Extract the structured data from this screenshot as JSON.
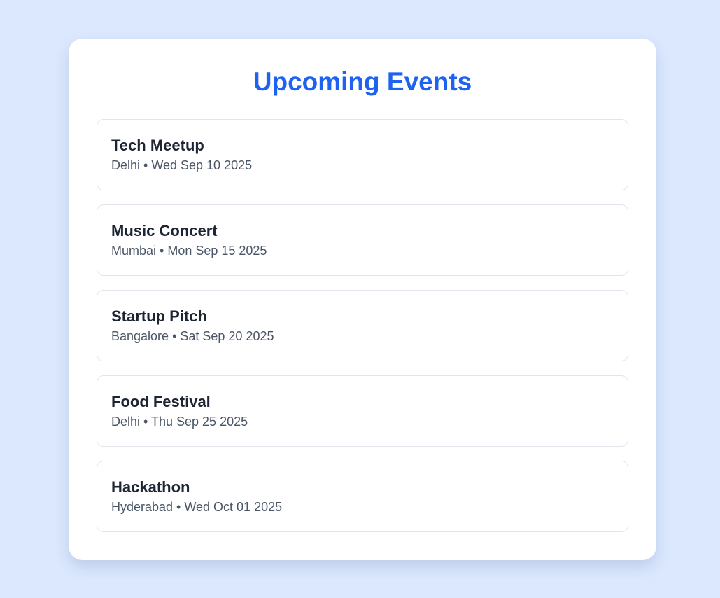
{
  "page": {
    "title": "Upcoming Events"
  },
  "events": [
    {
      "name": "Tech Meetup",
      "city": "Delhi",
      "date": "Wed Sep 10 2025",
      "meta": "Delhi • Wed Sep 10 2025"
    },
    {
      "name": "Music Concert",
      "city": "Mumbai",
      "date": "Mon Sep 15 2025",
      "meta": "Mumbai • Mon Sep 15 2025"
    },
    {
      "name": "Startup Pitch",
      "city": "Bangalore",
      "date": "Sat Sep 20 2025",
      "meta": "Bangalore • Sat Sep 20 2025"
    },
    {
      "name": "Food Festival",
      "city": "Delhi",
      "date": "Thu Sep 25 2025",
      "meta": "Delhi • Thu Sep 25 2025"
    },
    {
      "name": "Hackathon",
      "city": "Hyderabad",
      "date": "Wed Oct 01 2025",
      "meta": "Hyderabad • Wed Oct 01 2025"
    }
  ],
  "colors": {
    "background": "#dbe8fe",
    "title": "#1d62f0",
    "event_name": "#1d2433",
    "event_meta": "#4a5566",
    "item_border": "#e2e6ec"
  }
}
